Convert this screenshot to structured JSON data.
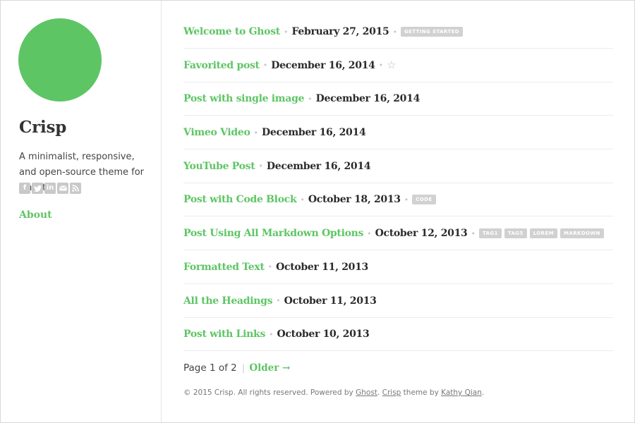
{
  "site": {
    "title": "Crisp",
    "description": "A minimalist, responsive, and open-source theme for Ghost",
    "nav_about": "About",
    "accent_color": "#5ec565",
    "avatar_color": "#5ec565",
    "social_icons": [
      "facebook-icon",
      "twitter-icon",
      "linkedin-icon",
      "email-icon",
      "rss-icon"
    ]
  },
  "posts": [
    {
      "title": "Welcome to Ghost",
      "date": "February 27, 2015",
      "tags": [
        "GETTING STARTED"
      ]
    },
    {
      "title": "Favorited post",
      "date": "December 16, 2014",
      "favorite": true
    },
    {
      "title": "Post with single image",
      "date": "December 16, 2014"
    },
    {
      "title": "Vimeo Video",
      "date": "December 16, 2014"
    },
    {
      "title": "YouTube Post",
      "date": "December 16, 2014"
    },
    {
      "title": "Post with Code Block",
      "date": "October 18, 2013",
      "tags": [
        "CODE"
      ]
    },
    {
      "title": "Post Using All Markdown Options",
      "date": "October 12, 2013",
      "tags": [
        "TAG1",
        "TAG5",
        "LOREM",
        "MARKDOWN"
      ]
    },
    {
      "title": "Formatted Text",
      "date": "October 11, 2013"
    },
    {
      "title": "All the Headings",
      "date": "October 11, 2013"
    },
    {
      "title": "Post with Links",
      "date": "October 10, 2013"
    }
  ],
  "pagination": {
    "text": "Page 1 of 2",
    "older_label": "Older →"
  },
  "footer": {
    "prefix": "© 2015 Crisp. All rights reserved. Powered by ",
    "ghost_link": "Ghost",
    "middle": ". ",
    "crisp_link": "Crisp",
    "theme_by": " theme by ",
    "author_link": "Kathy Qian",
    "suffix": "."
  }
}
